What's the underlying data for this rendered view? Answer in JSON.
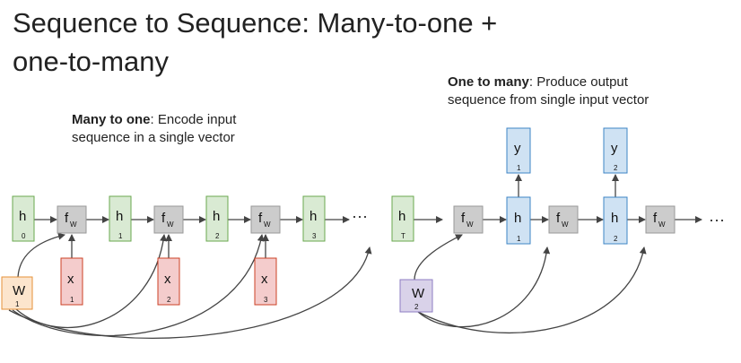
{
  "title": {
    "line1": "Sequence to Sequence: Many-to-one +",
    "line2": "one-to-many"
  },
  "many_to_one": {
    "bold": "Many to one",
    "rest": ": Encode input",
    "line2": "sequence in a single vector"
  },
  "one_to_many": {
    "bold": "One to many",
    "rest": ": Produce output",
    "line2": "sequence from single input vector"
  },
  "ellipsis": "···",
  "colors": {
    "hidden_green": "#d9ead3",
    "hidden_green_border": "#6aa84f",
    "func_gray": "#cccccc",
    "func_gray_border": "#999999",
    "input_red": "#f4cccc",
    "input_red_border": "#cc4125",
    "output_blue": "#cfe2f3",
    "output_blue_border": "#3d85c6",
    "weight1_orange": "#fce5cd",
    "weight1_border": "#e69138",
    "weight2_purple": "#d9d2e9",
    "weight2_border": "#8e7cc3"
  },
  "encoder": {
    "hidden": [
      {
        "label": "h",
        "sub": "0"
      },
      {
        "label": "h",
        "sub": "1"
      },
      {
        "label": "h",
        "sub": "2"
      },
      {
        "label": "h",
        "sub": "3"
      },
      {
        "label": "h",
        "sub": "T"
      }
    ],
    "functions": [
      {
        "label": "f",
        "sub": "W"
      },
      {
        "label": "f",
        "sub": "W"
      },
      {
        "label": "f",
        "sub": "W"
      }
    ],
    "inputs": [
      {
        "label": "x",
        "sub": "1"
      },
      {
        "label": "x",
        "sub": "2"
      },
      {
        "label": "x",
        "sub": "3"
      }
    ],
    "weight": {
      "label": "W",
      "sub": "1"
    }
  },
  "decoder": {
    "functions": [
      {
        "label": "f",
        "sub": "W"
      },
      {
        "label": "f",
        "sub": "W"
      },
      {
        "label": "f",
        "sub": "W"
      }
    ],
    "hidden": [
      {
        "label": "h",
        "sub": "1"
      },
      {
        "label": "h",
        "sub": "2"
      }
    ],
    "outputs": [
      {
        "label": "y",
        "sub": "1"
      },
      {
        "label": "y",
        "sub": "2"
      }
    ],
    "weight": {
      "label": "W",
      "sub": "2"
    }
  }
}
